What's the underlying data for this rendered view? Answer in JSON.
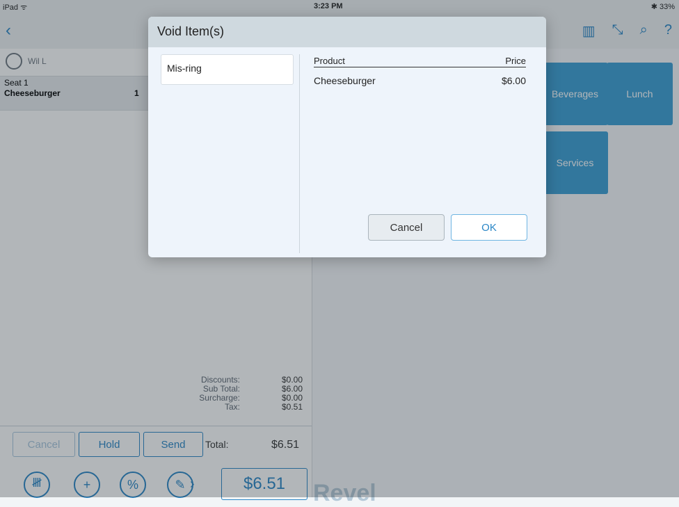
{
  "status_bar": {
    "device": "iPad ᯤ",
    "time": "3:23 PM",
    "battery": "✱ 33%"
  },
  "customer": {
    "name": "Wil L"
  },
  "seat": {
    "label": "Seat 1",
    "item": "Cheeseburger",
    "qty": "1"
  },
  "totals": [
    {
      "label": "Discounts:",
      "value": "$0.00"
    },
    {
      "label": "Sub Total:",
      "value": "$6.00"
    },
    {
      "label": "Surcharge:",
      "value": "$0.00"
    },
    {
      "label": "Tax:",
      "value": "$0.51"
    }
  ],
  "actions": {
    "cancel": "Cancel",
    "hold": "Hold",
    "send": "Send",
    "total_label": "Total:",
    "total_value": "$6.51",
    "amount_due": "$6.51"
  },
  "categories": [
    "Beverages",
    "Lunch",
    "Services"
  ],
  "brand": "Revel",
  "modal": {
    "title": "Void Item(s)",
    "reason": "Mis-ring",
    "product_header": "Product",
    "price_header": "Price",
    "items": [
      {
        "product": "Cheeseburger",
        "price": "$6.00"
      }
    ],
    "cancel": "Cancel",
    "ok": "OK"
  }
}
